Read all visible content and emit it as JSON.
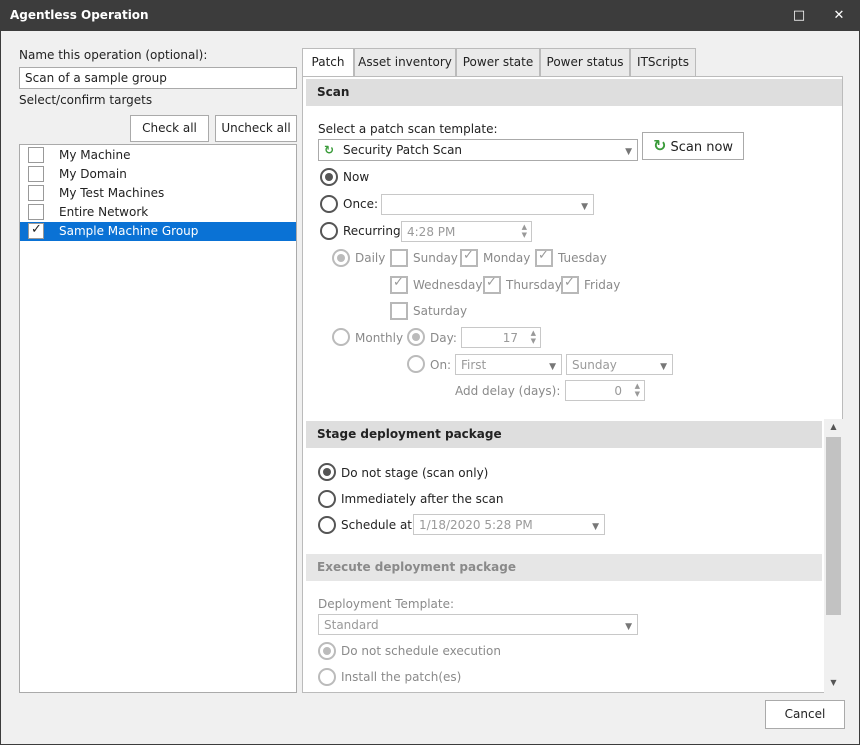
{
  "window": {
    "title": "Agentless Operation",
    "maximize_icon": "□",
    "close_icon": "✕"
  },
  "left": {
    "name_label": "Name this operation (optional):",
    "name_value": "Scan of a sample group",
    "targets_label": "Select/confirm targets",
    "check_all": "Check all",
    "uncheck_all": "Uncheck all",
    "targets": [
      {
        "label": "My Machine",
        "checked": false
      },
      {
        "label": "My Domain",
        "checked": false
      },
      {
        "label": "My Test Machines",
        "checked": false
      },
      {
        "label": "Entire Network",
        "checked": false
      },
      {
        "label": "Sample Machine Group",
        "checked": true
      }
    ]
  },
  "tabs": [
    "Patch",
    "Asset inventory",
    "Power state",
    "Power status",
    "ITScripts"
  ],
  "scan": {
    "header": "Scan",
    "template_label": "Select a patch scan template:",
    "template_value": "Security Patch Scan",
    "scan_now": "Scan now",
    "now": "Now",
    "once": "Once:",
    "recurring": "Recurring:",
    "recurring_time": "4:28 PM",
    "daily": "Daily",
    "days": {
      "sunday": "Sunday",
      "monday": "Monday",
      "tuesday": "Tuesday",
      "wednesday": "Wednesday",
      "thursday": "Thursday",
      "friday": "Friday",
      "saturday": "Saturday"
    },
    "monthly": "Monthly",
    "day_label": "Day:",
    "day_value": "17",
    "on_label": "On:",
    "on_week": "First",
    "on_weekday": "Sunday",
    "delay_label": "Add delay (days):",
    "delay_value": "0"
  },
  "stage": {
    "header": "Stage deployment package",
    "do_not_stage": "Do not stage (scan only)",
    "immediately": "Immediately after the scan",
    "schedule_at": "Schedule at:",
    "schedule_value": "1/18/2020 5:28 PM"
  },
  "execute": {
    "header": "Execute deployment package",
    "template_label": "Deployment Template:",
    "template_value": "Standard",
    "do_not_schedule": "Do not schedule execution",
    "install": "Install the patch(es)"
  },
  "footer": {
    "cancel": "Cancel"
  }
}
